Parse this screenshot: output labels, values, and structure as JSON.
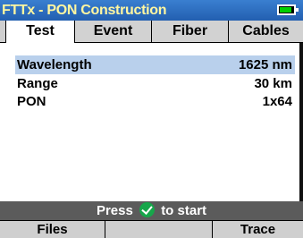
{
  "title_bar": {
    "title": "FTTx - PON Construction",
    "battery_icon": "battery-icon"
  },
  "tabs": [
    {
      "label": "Test"
    },
    {
      "label": "Event"
    },
    {
      "label": "Fiber"
    },
    {
      "label": "Cables"
    }
  ],
  "settings": [
    {
      "label": "Wavelength",
      "value": "1625 nm"
    },
    {
      "label": "Range",
      "value": "30 km"
    },
    {
      "label": "PON",
      "value": "1x64"
    }
  ],
  "status": {
    "prefix": "Press",
    "icon": "check-icon",
    "suffix": "to start"
  },
  "softkeys": [
    {
      "label": "Files"
    },
    {
      "label": ""
    },
    {
      "label": "Trace"
    }
  ],
  "colors": {
    "title_bg": "#2a6ac0",
    "title_text": "#fff6a0",
    "selected_row": "#b9d0ec",
    "status_bg": "#5b5b5b",
    "check": "#16a64a",
    "battery_fill": "#00d000"
  }
}
